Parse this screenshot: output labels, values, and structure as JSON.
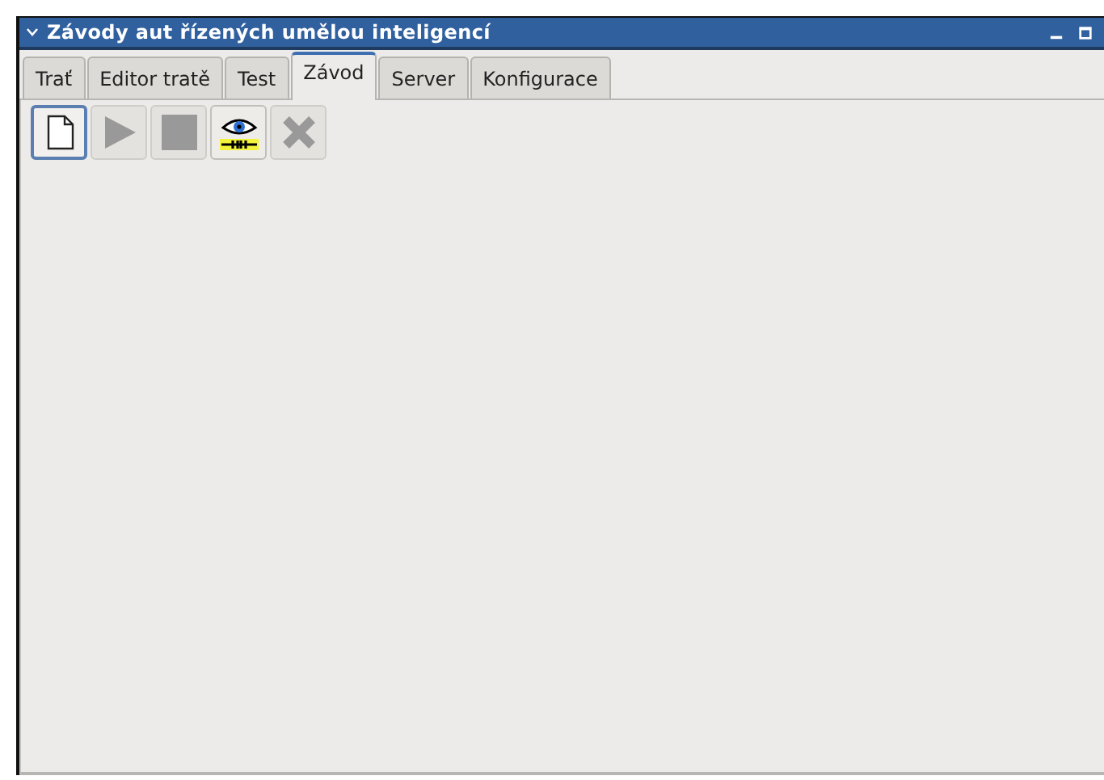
{
  "window": {
    "title": "Závody aut řízených umělou inteligencí"
  },
  "tabs": [
    {
      "label": "Trať",
      "selected": false
    },
    {
      "label": "Editor tratě",
      "selected": false
    },
    {
      "label": "Test",
      "selected": false
    },
    {
      "label": "Závod",
      "selected": true
    },
    {
      "label": "Server",
      "selected": false
    },
    {
      "label": "Konfigurace",
      "selected": false
    }
  ],
  "toolbar": [
    {
      "kind": "new",
      "disabled": false,
      "selected": true
    },
    {
      "kind": "play",
      "disabled": true,
      "selected": false
    },
    {
      "kind": "stop",
      "disabled": true,
      "selected": false
    },
    {
      "kind": "watch",
      "disabled": false,
      "selected": false
    },
    {
      "kind": "delete",
      "disabled": true,
      "selected": false
    }
  ]
}
